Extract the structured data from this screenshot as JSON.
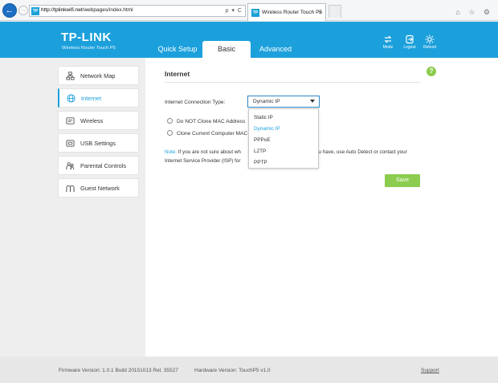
{
  "browser": {
    "url_host": "http://tplinkwifi.net",
    "url_path": "/webpages/index.html",
    "address_tools": "ρ ▾ C",
    "tab_title": "Wireless Router Touch P5",
    "tab_favicon": "TP",
    "tab_close": "×",
    "back_icon": "←",
    "forward_icon": "→",
    "window_icons": "⌂ ☆ ⚙"
  },
  "header": {
    "brand": "TP-LINK",
    "subtitle": "Wireless Router Touch P5",
    "tabs": [
      {
        "label": "Quick Setup"
      },
      {
        "label": "Basic"
      },
      {
        "label": "Advanced"
      }
    ],
    "buttons": [
      {
        "label": "Mode",
        "icon": "mode-icon"
      },
      {
        "label": "Logout",
        "icon": "logout-icon"
      },
      {
        "label": "Reboot",
        "icon": "reboot-icon"
      }
    ]
  },
  "sidebar": {
    "items": [
      {
        "label": "Network Map",
        "icon": "network-map-icon"
      },
      {
        "label": "Internet",
        "icon": "globe-icon",
        "active": true
      },
      {
        "label": "Wireless",
        "icon": "wireless-icon"
      },
      {
        "label": "USB Settings",
        "icon": "usb-icon"
      },
      {
        "label": "Parental Controls",
        "icon": "parental-controls-icon"
      },
      {
        "label": "Guest Network",
        "icon": "guest-network-icon"
      }
    ]
  },
  "main": {
    "title": "Internet",
    "help": "?",
    "connection_type_label": "Internet Connection Type:",
    "connection_type_value": "Dynamic IP",
    "radio_options": [
      {
        "label": "Do NOT Clone MAC Address"
      },
      {
        "label": "Clone Current Computer MAC"
      }
    ],
    "note_label": "Note:",
    "note_text_1": " If you are not sure about wh",
    "note_text_2": "you have, use Auto Detect or contact your",
    "note_text_3": "Internet Service Provider (ISP) for",
    "dropdown_options": [
      {
        "label": "Static IP"
      },
      {
        "label": "Dynamic IP",
        "selected": true
      },
      {
        "label": "PPPoE"
      },
      {
        "label": "L2TP"
      },
      {
        "label": "PPTP"
      }
    ],
    "save_label": "Save"
  },
  "footer": {
    "firmware": "Firmware Version: 1.0.1 Build 20151013 Rel. 35527",
    "hardware": "Hardware Version: TouchP5 v1.0",
    "support": "Support"
  },
  "colors": {
    "accent": "#1ca0dc",
    "save": "#8ccc4e"
  }
}
